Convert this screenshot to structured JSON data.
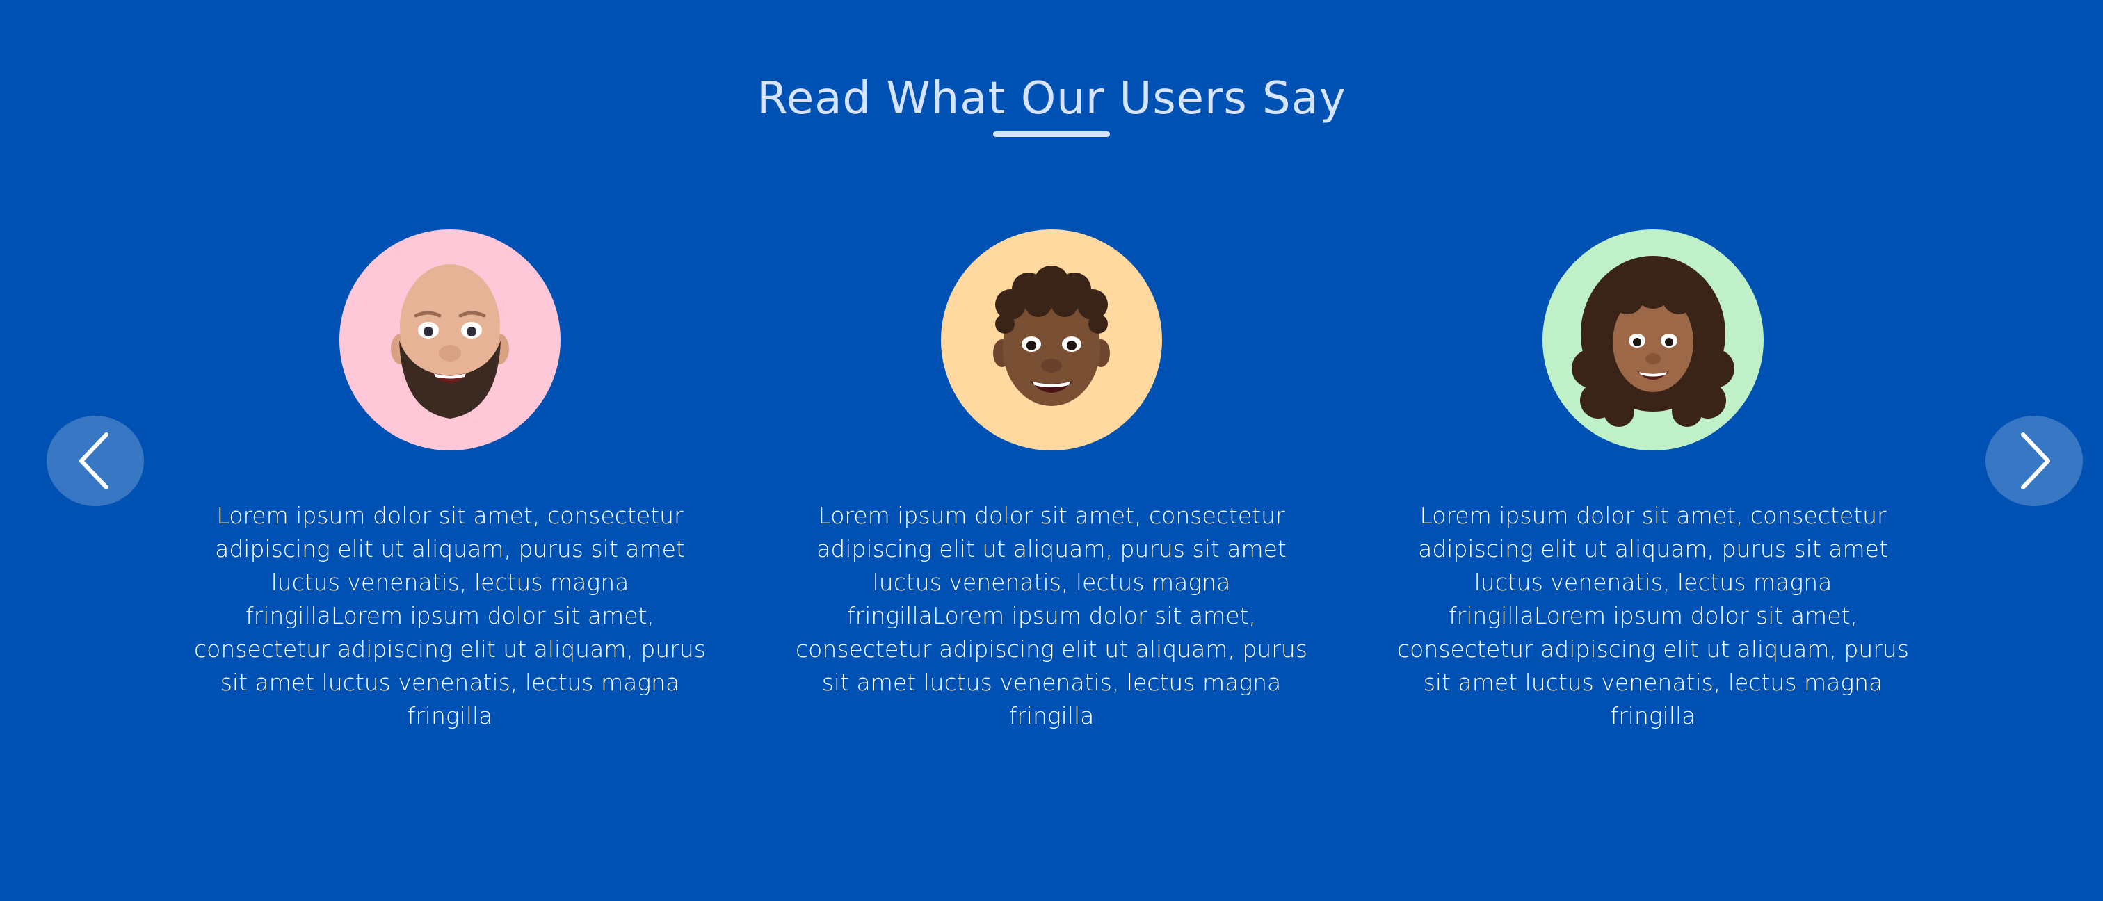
{
  "section": {
    "heading": "Read What Our Users Say"
  },
  "colors": {
    "background": "#0051B4",
    "heading": "#D6E4FF",
    "avatar_bg_1": "#FFC8D8",
    "avatar_bg_2": "#FFD9A0",
    "avatar_bg_3": "#BFF0C8"
  },
  "navigation": {
    "prev_icon": "chevron-left-icon",
    "next_icon": "chevron-right-icon"
  },
  "testimonials": [
    {
      "avatar_icon": "bald-bearded-man-memoji-avatar",
      "text": "Lorem ipsum dolor sit amet, consectetur adipiscing elit ut aliquam, purus sit amet luctus venenatis, lectus magna fringillaLorem ipsum dolor sit amet, consectetur adipiscing elit ut aliquam, purus sit amet luctus venenatis, lectus magna fringilla"
    },
    {
      "avatar_icon": "curly-haired-man-memoji-avatar",
      "text": "Lorem ipsum dolor sit amet, consectetur adipiscing elit ut aliquam, purus sit amet luctus venenatis, lectus magna fringillaLorem ipsum dolor sit amet, consectetur adipiscing elit ut aliquam, purus sit amet luctus venenatis, lectus magna fringilla"
    },
    {
      "avatar_icon": "curly-haired-woman-memoji-avatar",
      "text": "Lorem ipsum dolor sit amet, consectetur adipiscing elit ut aliquam, purus sit amet luctus venenatis, lectus magna fringillaLorem ipsum dolor sit amet, consectetur adipiscing elit ut aliquam, purus sit amet luctus venenatis, lectus magna fringilla"
    }
  ]
}
